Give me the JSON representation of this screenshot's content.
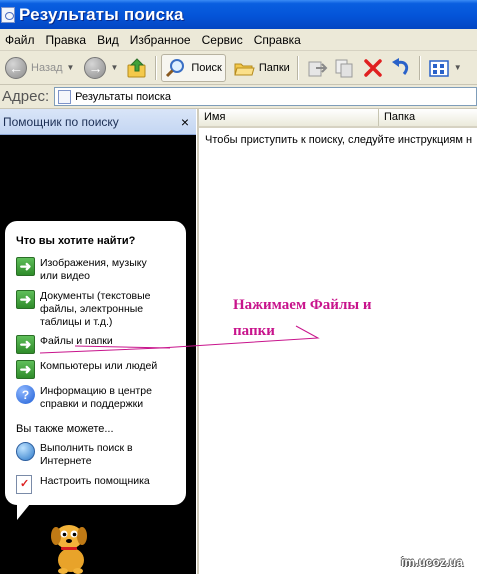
{
  "window": {
    "title": "Результаты поиска"
  },
  "menu": [
    "Файл",
    "Правка",
    "Вид",
    "Избранное",
    "Сервис",
    "Справка"
  ],
  "toolbar": {
    "back_label": "Назад",
    "search_label": "Поиск",
    "folders_label": "Папки"
  },
  "address": {
    "label": "Адрес:",
    "value": "Результаты поиска"
  },
  "search_pane": {
    "title": "Помощник по поиску",
    "close_glyph": "×",
    "question": "Что вы хотите найти?",
    "options": [
      "Изображения, музыку или видео",
      "Документы (текстовые файлы, электронные таблицы и т.д.)",
      "Файлы и папки",
      "Компьютеры или людей",
      "Информацию в центре справки и поддержки"
    ],
    "also_label": "Вы также можете...",
    "also_options": [
      "Выполнить поиск в Интернете",
      "Настроить помощника"
    ]
  },
  "results": {
    "columns": [
      "Имя",
      "Папка"
    ],
    "hint": "Чтобы приступить к поиску, следуйте инструкциям н"
  },
  "annotation": {
    "line1": "Нажимаем Файлы и",
    "line2": "папки",
    "color": "#c8148c"
  },
  "watermark": "im.ucoz.ua",
  "colors": {
    "titlebar": "#0454d8",
    "chrome": "#ece9d8",
    "pane_bg": "#000000",
    "accent_arrow": "#2f8b2a"
  },
  "icons": [
    "app-folder-search-icon",
    "back-icon",
    "forward-icon",
    "up-folder-icon",
    "search-icon",
    "folders-icon",
    "move-to-icon",
    "copy-to-icon",
    "delete-icon",
    "undo-icon",
    "views-icon",
    "dog-assistant-icon"
  ]
}
